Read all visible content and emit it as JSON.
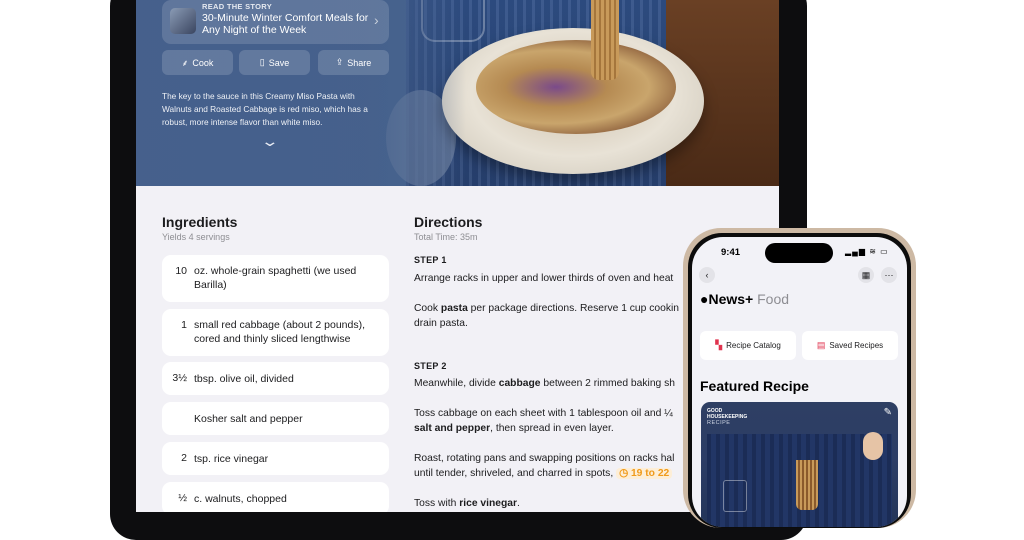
{
  "ipad": {
    "hero": {
      "story_kicker": "READ THE STORY",
      "story_title": "30-Minute Winter Comfort Meals for Any Night of the Week",
      "buttons": [
        {
          "icon": "whisk-icon",
          "label": "Cook"
        },
        {
          "icon": "bookmark-icon",
          "label": "Save"
        },
        {
          "icon": "share-icon",
          "label": "Share"
        }
      ],
      "description": "The key to the sauce in this Creamy Miso Pasta with Walnuts and Roasted Cabbage is red miso, which has a robust, more intense flavor than white miso."
    },
    "ingredients": {
      "title": "Ingredients",
      "subtitle": "Yields 4 servings",
      "items": [
        {
          "qty": "10",
          "text": "oz. whole-grain spaghetti (we used Barilla)"
        },
        {
          "qty": "1",
          "text": "small red cabbage (about 2 pounds), cored and thinly sliced lengthwise"
        },
        {
          "qty": "3½",
          "text": "tbsp. olive oil, divided"
        },
        {
          "qty": "",
          "text": "Kosher salt and pepper"
        },
        {
          "qty": "2",
          "text": "tsp. rice vinegar"
        },
        {
          "qty": "½",
          "text": "c. walnuts, chopped"
        }
      ]
    },
    "directions": {
      "title": "Directions",
      "total_time": "Total Time: 35m",
      "step1_label": "STEP 1",
      "step1_p1": "Arrange racks in upper and lower thirds of oven and heat",
      "step1_p2_pre": "Cook ",
      "step1_p2_bold": "pasta",
      "step1_p2_post": " per package directions. Reserve 1 cup cookin",
      "step1_p2_line2": "drain pasta.",
      "step2_label": "STEP 2",
      "step2_p1_pre": "Meanwhile, divide ",
      "step2_p1_bold": "cabbage",
      "step2_p1_post": " between 2 rimmed baking sh",
      "step2_p2_line1": "Toss cabbage on each sheet with 1 tablespoon oil and ¼",
      "step2_p2_bold": "salt and pepper",
      "step2_p2_post": ", then spread in even layer.",
      "step2_p3_line1": "Roast, rotating pans and swapping positions on racks hal",
      "step2_p3_line2": "until tender, shriveled, and charred in spots,",
      "step2_timer": "19 to 22",
      "step2_p4_pre": "Toss with ",
      "step2_p4_bold": "rice vinegar",
      "step2_p4_post": "."
    }
  },
  "iphone": {
    "time": "9:41",
    "status": "▂▄▆ ≋ ▭",
    "brand": "News+",
    "brand_section": "Food",
    "chips": [
      {
        "icon": "recipe-catalog-icon",
        "label": "Recipe Catalog"
      },
      {
        "icon": "saved-recipes-icon",
        "label": "Saved Recipes"
      }
    ],
    "featured_title": "Featured Recipe",
    "card_logo": "GOOD HOUSEKEEPING",
    "card_kicker": "RECIPE"
  }
}
